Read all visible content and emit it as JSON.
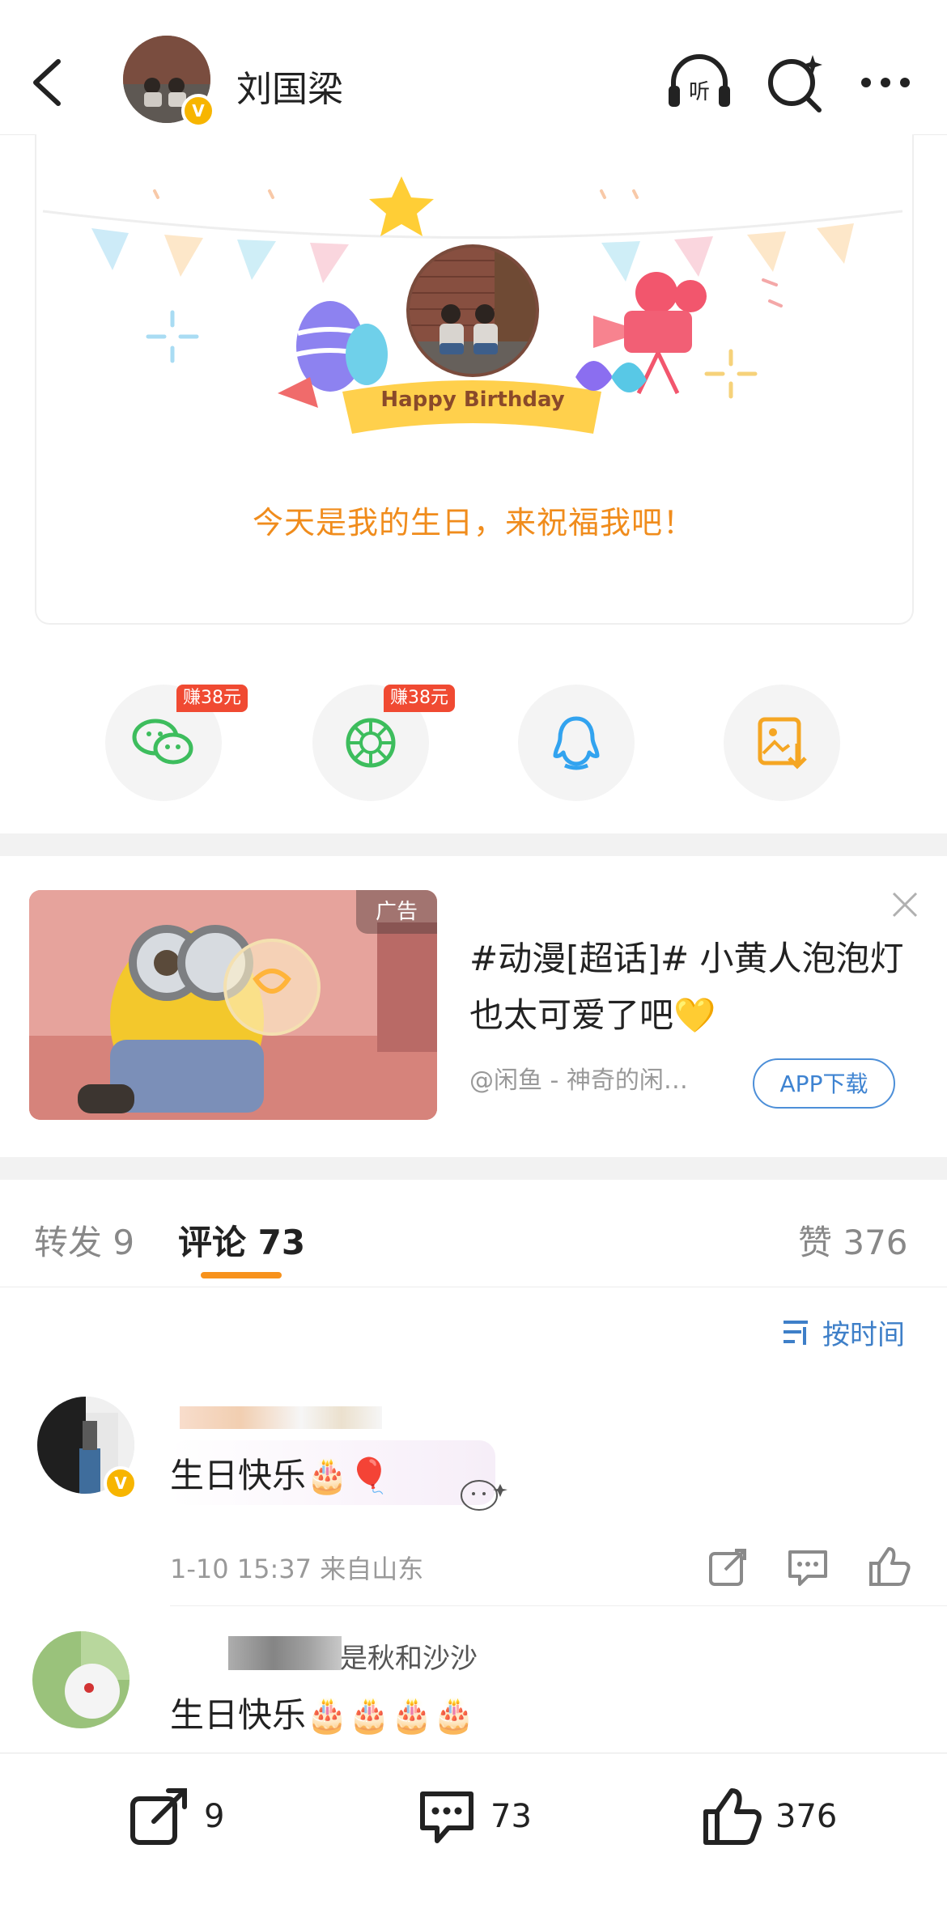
{
  "header": {
    "username": "刘国梁",
    "listen_icon_label": "听"
  },
  "birthday": {
    "banner_text": "Happy Birthday",
    "message": "今天是我的生日，来祝福我吧！"
  },
  "share": {
    "items": [
      {
        "icon": "wechat-icon",
        "badge": "赚38元",
        "color": "#3dbd5d"
      },
      {
        "icon": "moments-icon",
        "badge": "赚38元",
        "color": "#3dbd5d"
      },
      {
        "icon": "qq-icon",
        "badge": "",
        "color": "#32a3ef"
      },
      {
        "icon": "save-image-icon",
        "badge": "",
        "color": "#f5a623"
      }
    ]
  },
  "ad": {
    "tag": "广告",
    "title": "#动漫[超话]# 小黄人泡泡灯也太可爱了吧💛",
    "source": "@闲鱼 - 神奇的闲…",
    "button": "APP下载"
  },
  "tabs": {
    "repost": "转发 9",
    "comments": "评论 73",
    "likes": "赞 376"
  },
  "sort": {
    "label": "按时间"
  },
  "comments": [
    {
      "text": "生日快乐🎂🎈",
      "meta": "1-10 15:37 来自山东"
    },
    {
      "name_visible": "是秋和沙沙",
      "text": "生日快乐🎂🎂🎂🎂"
    }
  ],
  "bottom_bar": {
    "repost_count": "9",
    "comment_count": "73",
    "like_count": "376"
  },
  "colors": {
    "accent_orange": "#f7921c",
    "link_blue": "#3e7fc8",
    "badge_red": "#f04a32",
    "verify_gold": "#f7b500"
  }
}
